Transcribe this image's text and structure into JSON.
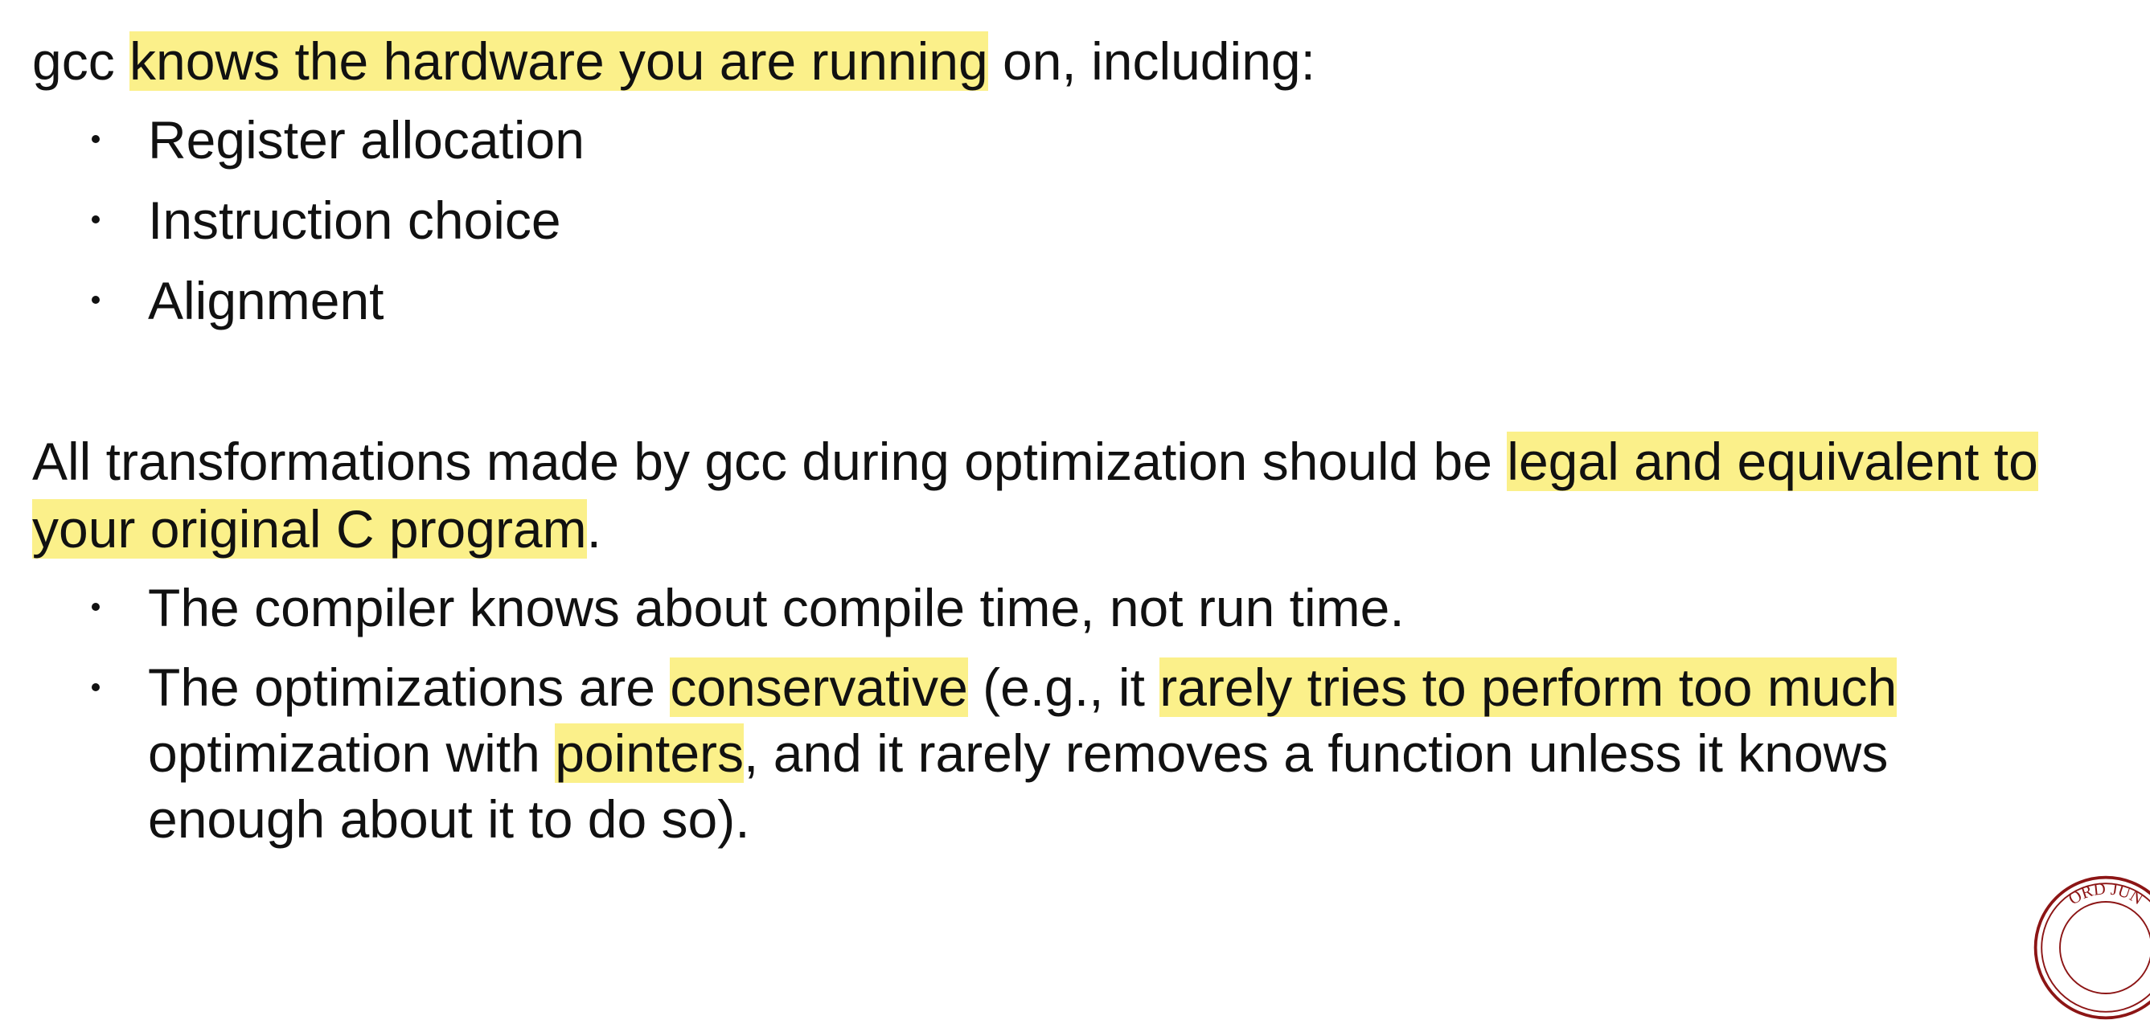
{
  "para1": {
    "pre": "gcc ",
    "highlight": "knows the hardware you are running",
    "post": " on, including:"
  },
  "list1": [
    "Register allocation",
    "Instruction choice",
    "Alignment"
  ],
  "para2": {
    "pre": "All transformations made by gcc during optimization should be ",
    "highlight": "legal and equivalent to your original C program",
    "post": "."
  },
  "list2": {
    "item1": "The compiler knows about compile time, not run time.",
    "item2": {
      "t1": "The optimizations are ",
      "h1": "conservative",
      "t2": " (e.g., it ",
      "h2": "rarely tries to perform too much",
      "t3": " optimization with ",
      "h3": "pointers",
      "t4": ", and it rarely removes a function unless it knows enough about it to do so)."
    }
  },
  "seal": {
    "text": "ORD JUN",
    "color": "#8c1515"
  },
  "colors": {
    "highlight": "#fbf08a",
    "text": "#111111"
  }
}
